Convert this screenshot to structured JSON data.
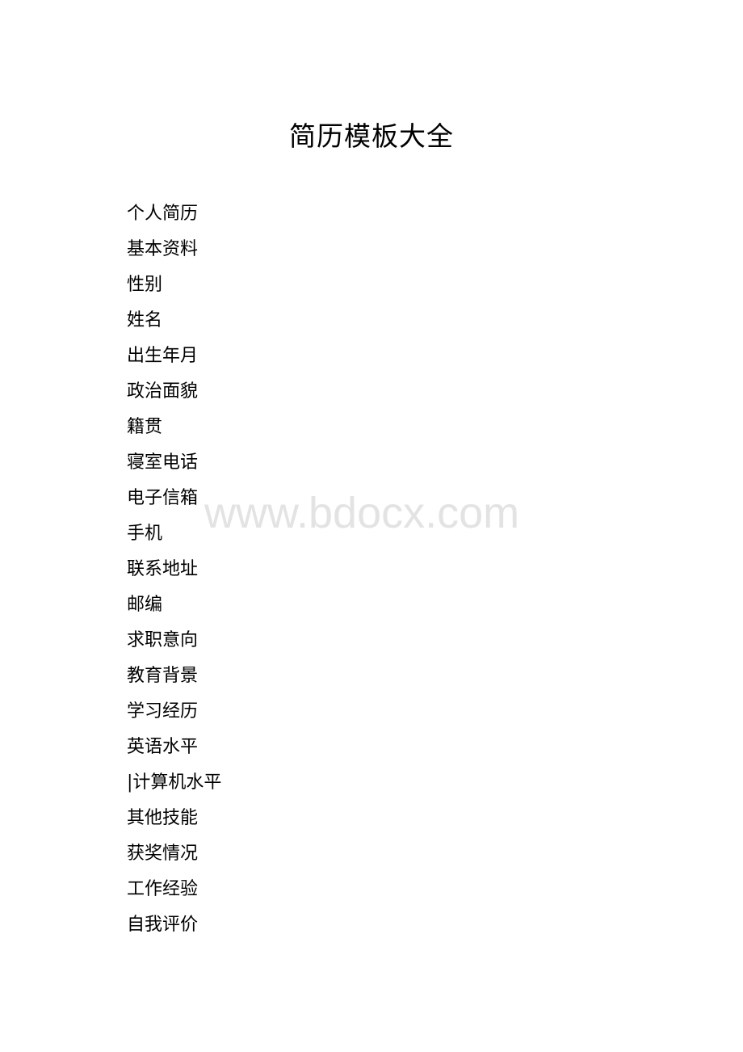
{
  "document": {
    "title": "简历模板大全",
    "items": [
      "个人简历",
      "基本资料",
      "性别",
      "姓名",
      "出生年月",
      "政治面貌",
      "籍贯",
      "寝室电话",
      "电子信箱",
      "手机",
      "联系地址",
      "邮编",
      "求职意向",
      "教育背景",
      "学习经历",
      "英语水平",
      "|计算机水平",
      "其他技能",
      "获奖情况",
      "工作经验",
      "自我评价"
    ]
  },
  "watermark": {
    "text": "www.bdocx.com",
    "color": "#e3e3e3"
  }
}
